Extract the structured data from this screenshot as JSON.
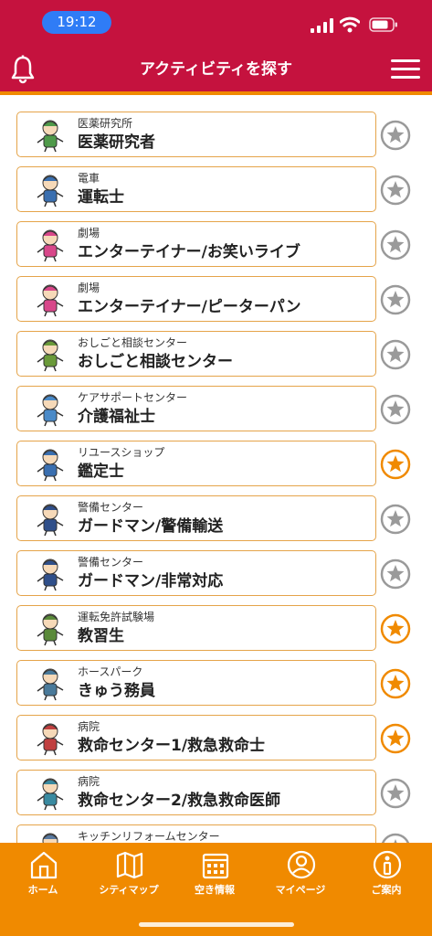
{
  "status_bar": {
    "time": "19:12"
  },
  "header": {
    "title": "アクティビティを探す"
  },
  "colors": {
    "brand_red": "#c5123e",
    "accent_orange": "#f08a00",
    "card_border": "#e5a44a",
    "fav_star": "#f08a00",
    "default_star": "#9a9a9a"
  },
  "activities": [
    {
      "place": "医薬研究所",
      "job": "医薬研究者",
      "favorite": false,
      "icon": "researcher-character-icon"
    },
    {
      "place": "電車",
      "job": "運転士",
      "favorite": false,
      "icon": "train-driver-icon"
    },
    {
      "place": "劇場",
      "job": "エンターテイナー/お笑いライブ",
      "favorite": false,
      "icon": "entertainer-character-icon"
    },
    {
      "place": "劇場",
      "job": "エンターテイナー/ピーターパン",
      "favorite": false,
      "icon": "entertainer-character-icon"
    },
    {
      "place": "おしごと相談センター",
      "job": "おしごと相談センター",
      "favorite": false,
      "icon": "consultation-desk-icon"
    },
    {
      "place": "ケアサポートセンター",
      "job": "介護福祉士",
      "favorite": false,
      "icon": "caregiver-wheelchair-icon"
    },
    {
      "place": "リユースショップ",
      "job": "鑑定士",
      "favorite": true,
      "icon": "appraiser-character-icon"
    },
    {
      "place": "警備センター",
      "job": "ガードマン/警備輸送",
      "favorite": false,
      "icon": "guard-character-icon"
    },
    {
      "place": "警備センター",
      "job": "ガードマン/非常対応",
      "favorite": false,
      "icon": "guard-character-icon"
    },
    {
      "place": "運転免許試験場",
      "job": "教習生",
      "favorite": true,
      "icon": "driving-student-icon"
    },
    {
      "place": "ホースパーク",
      "job": "きゅう務員",
      "favorite": true,
      "icon": "stable-worker-icon"
    },
    {
      "place": "病院",
      "job": "救命センター1/救急救命士",
      "favorite": true,
      "icon": "paramedic-character-icon"
    },
    {
      "place": "病院",
      "job": "救命センター2/救急救命医師",
      "favorite": false,
      "icon": "doctor-character-icon"
    },
    {
      "place": "キッチンリフォームセンター",
      "job": "",
      "favorite": false,
      "icon": "kitchen-reform-icon"
    }
  ],
  "tabs": [
    {
      "label": "ホーム",
      "icon": "home-icon"
    },
    {
      "label": "シティマップ",
      "icon": "map-icon"
    },
    {
      "label": "空き情報",
      "icon": "calendar-icon"
    },
    {
      "label": "マイページ",
      "icon": "user-icon"
    },
    {
      "label": "ご案内",
      "icon": "info-icon"
    }
  ]
}
